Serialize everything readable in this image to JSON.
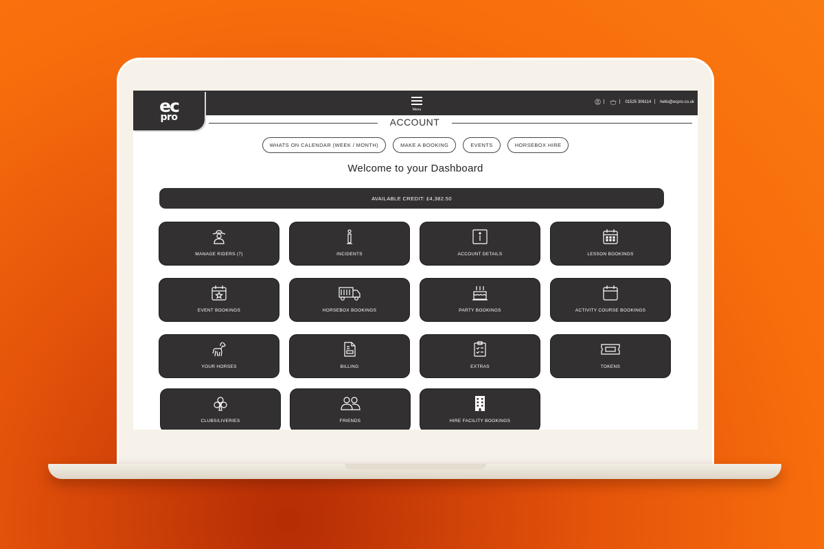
{
  "header": {
    "logo_top": "ec",
    "logo_bottom": "pro",
    "menu_label": "Menu",
    "phone": "01525 306114",
    "email": "hello@ecpro.co.uk",
    "divider": "|"
  },
  "page": {
    "title": "ACCOUNT",
    "welcome": "Welcome to your Dashboard",
    "credit": "AVAILABLE CREDIT: £4,382.50"
  },
  "nav_pills": [
    {
      "label": "WHATS ON CALENDAR (WEEK / MONTH)"
    },
    {
      "label": "MAKE A BOOKING"
    },
    {
      "label": "EVENTS"
    },
    {
      "label": "HORSEBOX HIRE"
    }
  ],
  "tiles": [
    {
      "label": "MANAGE RIDERS (7)",
      "icon": "rider-icon"
    },
    {
      "label": "INCIDENTS",
      "icon": "incident-icon"
    },
    {
      "label": "ACCOUNT DETAILS",
      "icon": "info-icon"
    },
    {
      "label": "LESSON BOOKINGS",
      "icon": "calendar-grid-icon"
    },
    {
      "label": "EVENT BOOKINGS",
      "icon": "calendar-star-icon"
    },
    {
      "label": "HORSEBOX BOOKINGS",
      "icon": "truck-icon"
    },
    {
      "label": "PARTY BOOKINGS",
      "icon": "cake-icon"
    },
    {
      "label": "ACTIVITY COURSE BOOKINGS",
      "icon": "calendar-icon"
    },
    {
      "label": "YOUR HORSES",
      "icon": "horse-icon"
    },
    {
      "label": "BILLING",
      "icon": "invoice-icon"
    },
    {
      "label": "EXTRAS",
      "icon": "clipboard-icon"
    },
    {
      "label": "TOKENS",
      "icon": "ticket-icon"
    },
    {
      "label": "CLUBS/LIVERIES",
      "icon": "club-icon"
    },
    {
      "label": "FRIENDS",
      "icon": "friends-icon"
    },
    {
      "label": "HIRE FACILITY BOOKINGS",
      "icon": "building-icon"
    }
  ],
  "colors": {
    "background": "#f76d0c",
    "dark": "#323031",
    "screen": "#ffffff"
  }
}
